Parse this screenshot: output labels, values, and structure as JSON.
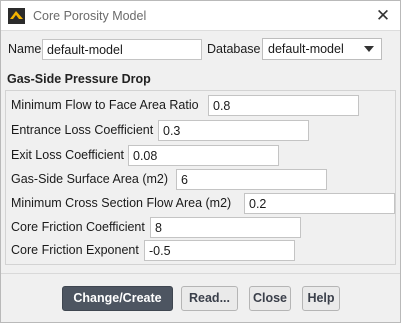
{
  "window": {
    "title": "Core Porosity Model",
    "app_icon": "ansys-fluent-icon",
    "close_glyph": "✕"
  },
  "header": {
    "name_label": "Name",
    "name_value": "default-model",
    "database_label": "Database",
    "database_value": "default-model"
  },
  "group": {
    "title": "Gas-Side Pressure Drop",
    "fields": [
      {
        "label": "Minimum Flow to Face Area Ratio",
        "value": "0.8"
      },
      {
        "label": "Entrance Loss Coefficient",
        "value": "0.3"
      },
      {
        "label": "Exit Loss Coefficient",
        "value": "0.08"
      },
      {
        "label": "Gas-Side Surface Area (m2)",
        "value": "6"
      },
      {
        "label": "Minimum Cross Section Flow Area (m2)",
        "value": "0.2"
      },
      {
        "label": "Core Friction Coefficient",
        "value": "8"
      },
      {
        "label": "Core Friction Exponent",
        "value": "-0.5"
      }
    ]
  },
  "buttons": {
    "change_create": "Change/Create",
    "read": "Read...",
    "close": "Close",
    "help": "Help"
  },
  "colors": {
    "primary_button": "#4d5561",
    "window_bg": "#f0f0f0",
    "titlebar_bg": "#ffffff"
  }
}
